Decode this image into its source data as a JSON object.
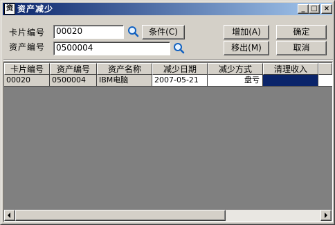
{
  "window": {
    "title": "资产减少",
    "icon_glyph": "资",
    "min_glyph": "_",
    "max_glyph": "□",
    "close_glyph": "×"
  },
  "form": {
    "card_no_label": "卡片编号",
    "card_no_value": "00020",
    "asset_no_label": "资产编号",
    "asset_no_value": "0500004",
    "condition_button": "条件(C)",
    "add_button": "增加(A)",
    "confirm_button": "确定",
    "remove_button": "移出(M)",
    "cancel_button": "取消"
  },
  "grid": {
    "columns": [
      "卡片编号",
      "资产编号",
      "资产名称",
      "减少日期",
      "减少方式",
      "清理收入"
    ],
    "rows": [
      [
        "00020",
        "0500004",
        "IBM电脑",
        "2007-05-21",
        "盘亏",
        ""
      ]
    ]
  },
  "colors": {
    "titlebar_start": "#0a246a",
    "titlebar_end": "#a6caf0",
    "selected_cell": "#0a246a",
    "grid_background": "#808080"
  }
}
